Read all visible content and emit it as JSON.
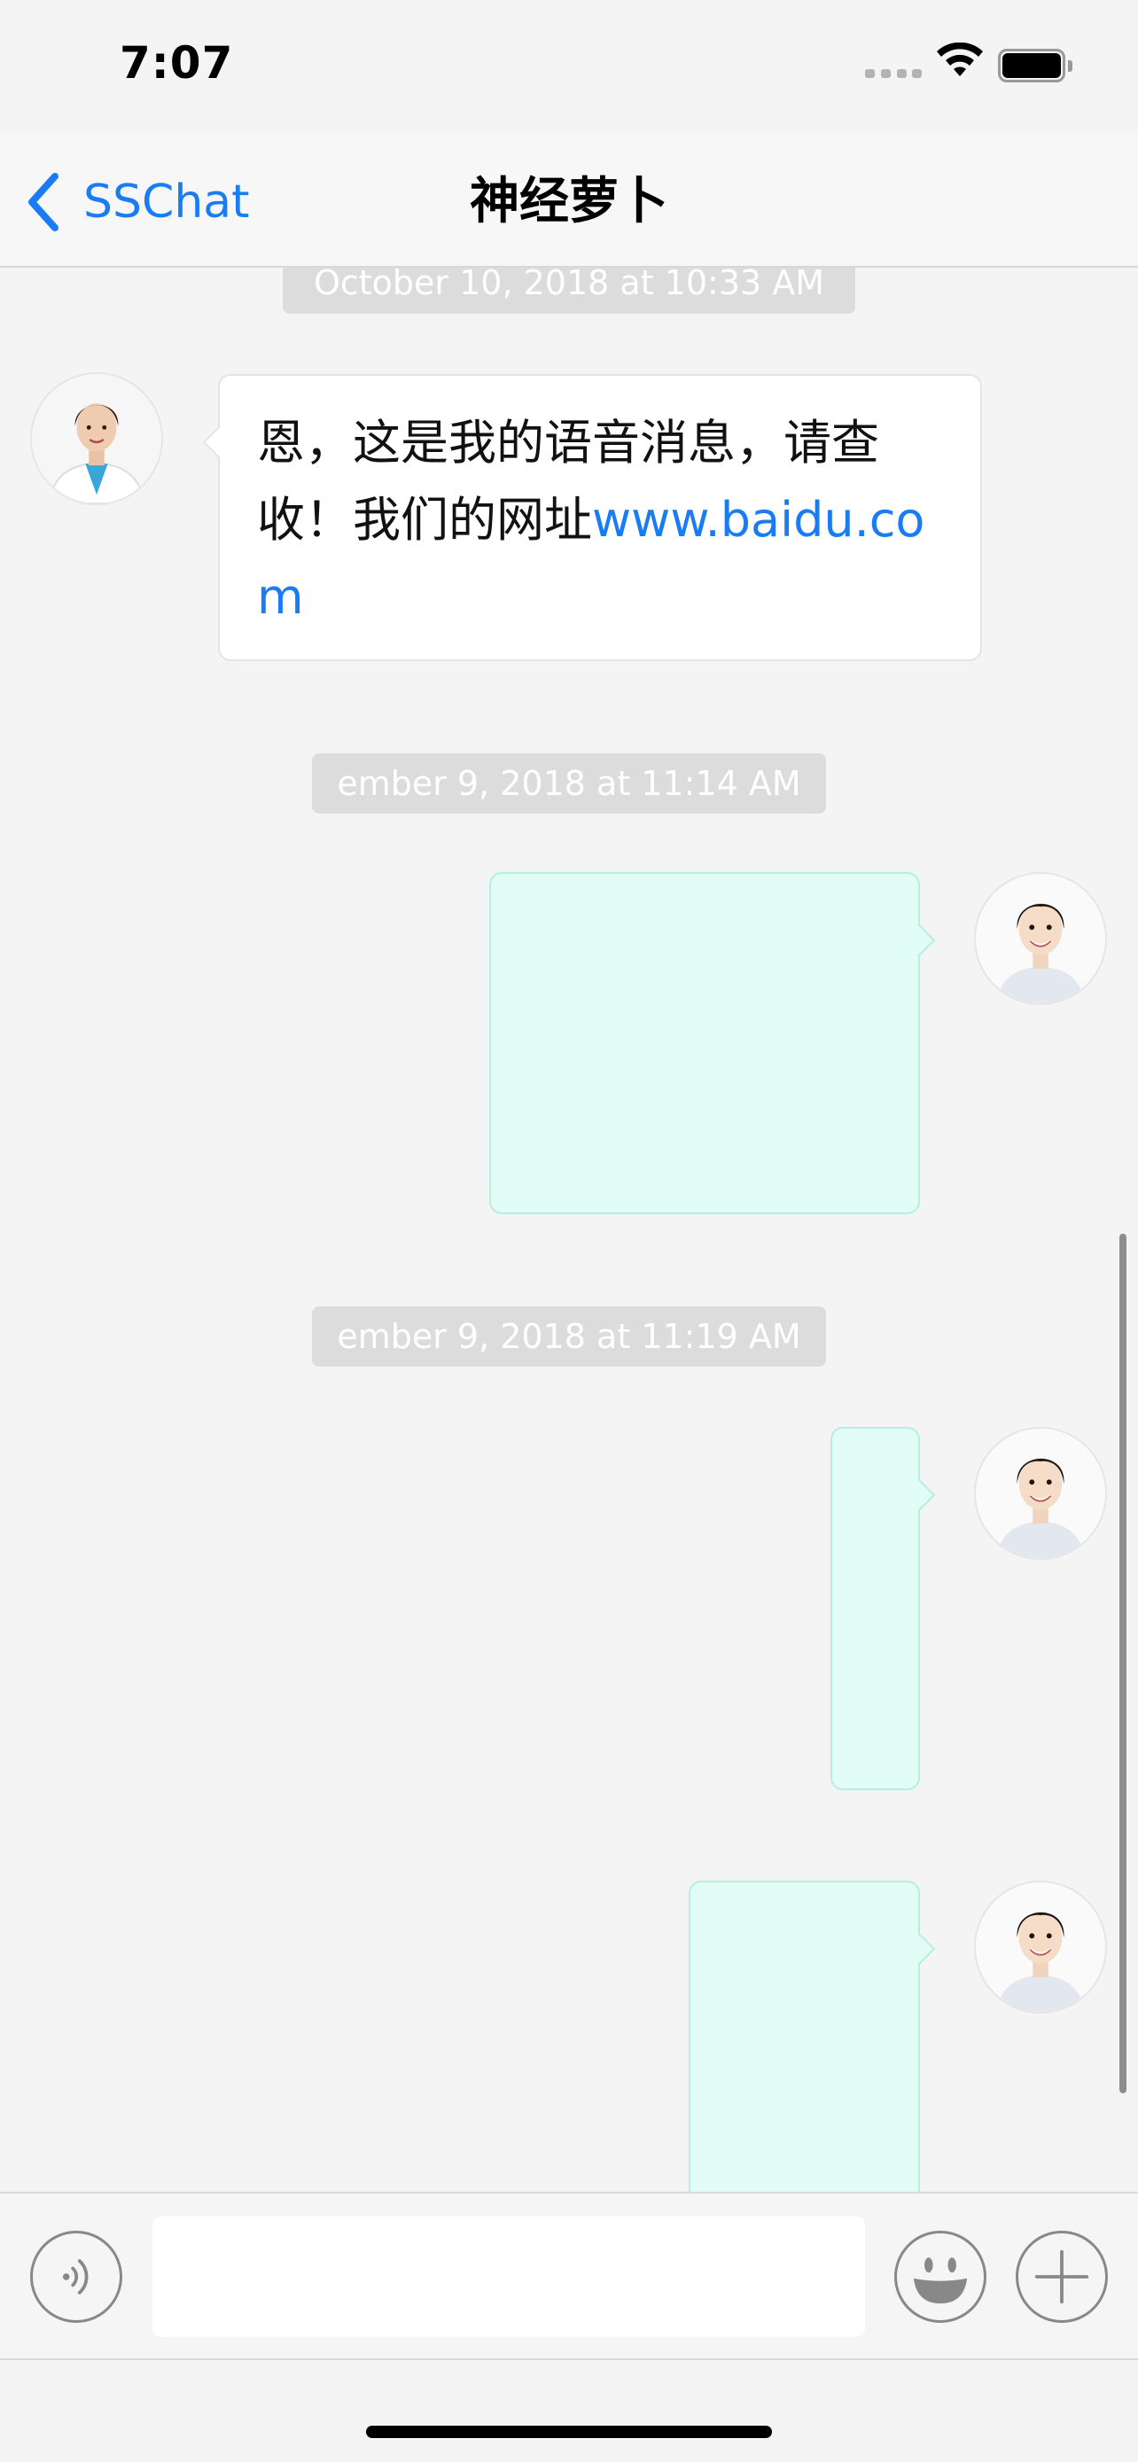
{
  "status_bar": {
    "time": "7:07",
    "icons": [
      "cellular-signal-icon",
      "wifi-icon",
      "battery-icon"
    ]
  },
  "nav": {
    "back_label": "SSChat",
    "title": "神经萝卜",
    "back_icon": "chevron-left-icon"
  },
  "messages": [
    {
      "type": "timestamp",
      "text": "October 10, 2018 at 10:33 AM"
    },
    {
      "type": "text",
      "direction": "incoming",
      "text": "恩，这是我的语音消息，请查收！我们的网址",
      "link": "www.baidu.com"
    },
    {
      "type": "timestamp",
      "text": "ember 9, 2018 at 11:14 AM"
    },
    {
      "type": "media",
      "direction": "outgoing"
    },
    {
      "type": "timestamp",
      "text": "ember 9, 2018 at 11:19 AM"
    },
    {
      "type": "media",
      "direction": "outgoing"
    },
    {
      "type": "media",
      "direction": "outgoing"
    }
  ],
  "input_bar": {
    "text_value": "",
    "voice_icon": "voice-icon",
    "emoji_icon": "emoji-icon",
    "plus_icon": "plus-icon"
  },
  "colors": {
    "accent": "#1a7cf5",
    "background": "#f4f4f4",
    "outgoing_bubble": "#e1fdf6",
    "incoming_bubble": "#ffffff",
    "timestamp_bg": "#dcdcdc"
  }
}
